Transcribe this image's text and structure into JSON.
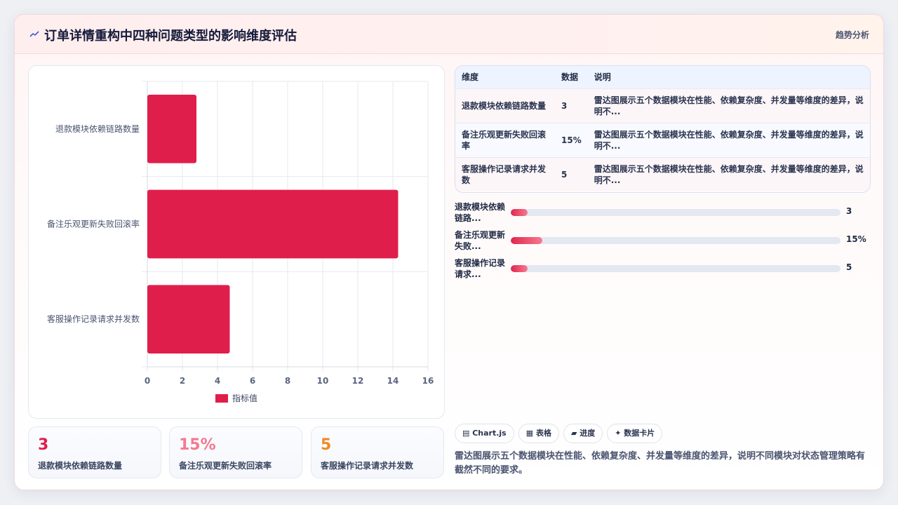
{
  "header": {
    "title": "订单详情重构中四种问题类型的影响维度评估",
    "right_label": "趋势分析",
    "icon": "trend-line-icon"
  },
  "colors": {
    "bar": "#e01e4b",
    "kpi1": "#e01e4b",
    "kpi2": "#f47a8f",
    "kpi3": "#f08a24"
  },
  "chart_data": {
    "type": "bar",
    "orientation": "horizontal",
    "categories": [
      "退款模块依赖链路数量",
      "备注乐观更新失败回滚率",
      "客服操作记录请求并发数"
    ],
    "series": [
      {
        "name": "指标值",
        "values": [
          2.8,
          14.3,
          4.7
        ]
      }
    ],
    "xlim": [
      0,
      16
    ],
    "xticks": [
      "0",
      "2",
      "4",
      "6",
      "8",
      "10",
      "12",
      "14",
      "16"
    ],
    "grid": true,
    "legend": "bottom"
  },
  "kpis": [
    {
      "value": "3",
      "label": "退款模块依赖链路数量"
    },
    {
      "value": "15%",
      "label": "备注乐观更新失败回滚率"
    },
    {
      "value": "5",
      "label": "客服操作记录请求并发数"
    }
  ],
  "table": {
    "headers": [
      "维度",
      "数据",
      "说明"
    ],
    "rows": [
      [
        "退款模块依赖链路数量",
        "3",
        "雷达图展示五个数据模块在性能、依赖复杂度、并发量等维度的差异，说明不..."
      ],
      [
        "备注乐观更新失败回滚率",
        "15%",
        "雷达图展示五个数据模块在性能、依赖复杂度、并发量等维度的差异，说明不..."
      ],
      [
        "客服操作记录请求并发数",
        "5",
        "雷达图展示五个数据模块在性能、依赖复杂度、并发量等维度的差异，说明不..."
      ]
    ]
  },
  "progress": [
    {
      "label": "退款模块依赖链路...",
      "value": "3",
      "fraction": 0.05
    },
    {
      "label": "备注乐观更新失败...",
      "value": "15%",
      "fraction": 0.095
    },
    {
      "label": "客服操作记录请求...",
      "value": "5",
      "fraction": 0.05
    }
  ],
  "tags": [
    "▤ Chart.js",
    "▦ 表格",
    "▰ 进度",
    "✦ 数据卡片"
  ],
  "footnote": "雷达图展示五个数据模块在性能、依赖复杂度、并发量等维度的差异，说明不同模块对状态管理策略有截然不同的要求。"
}
